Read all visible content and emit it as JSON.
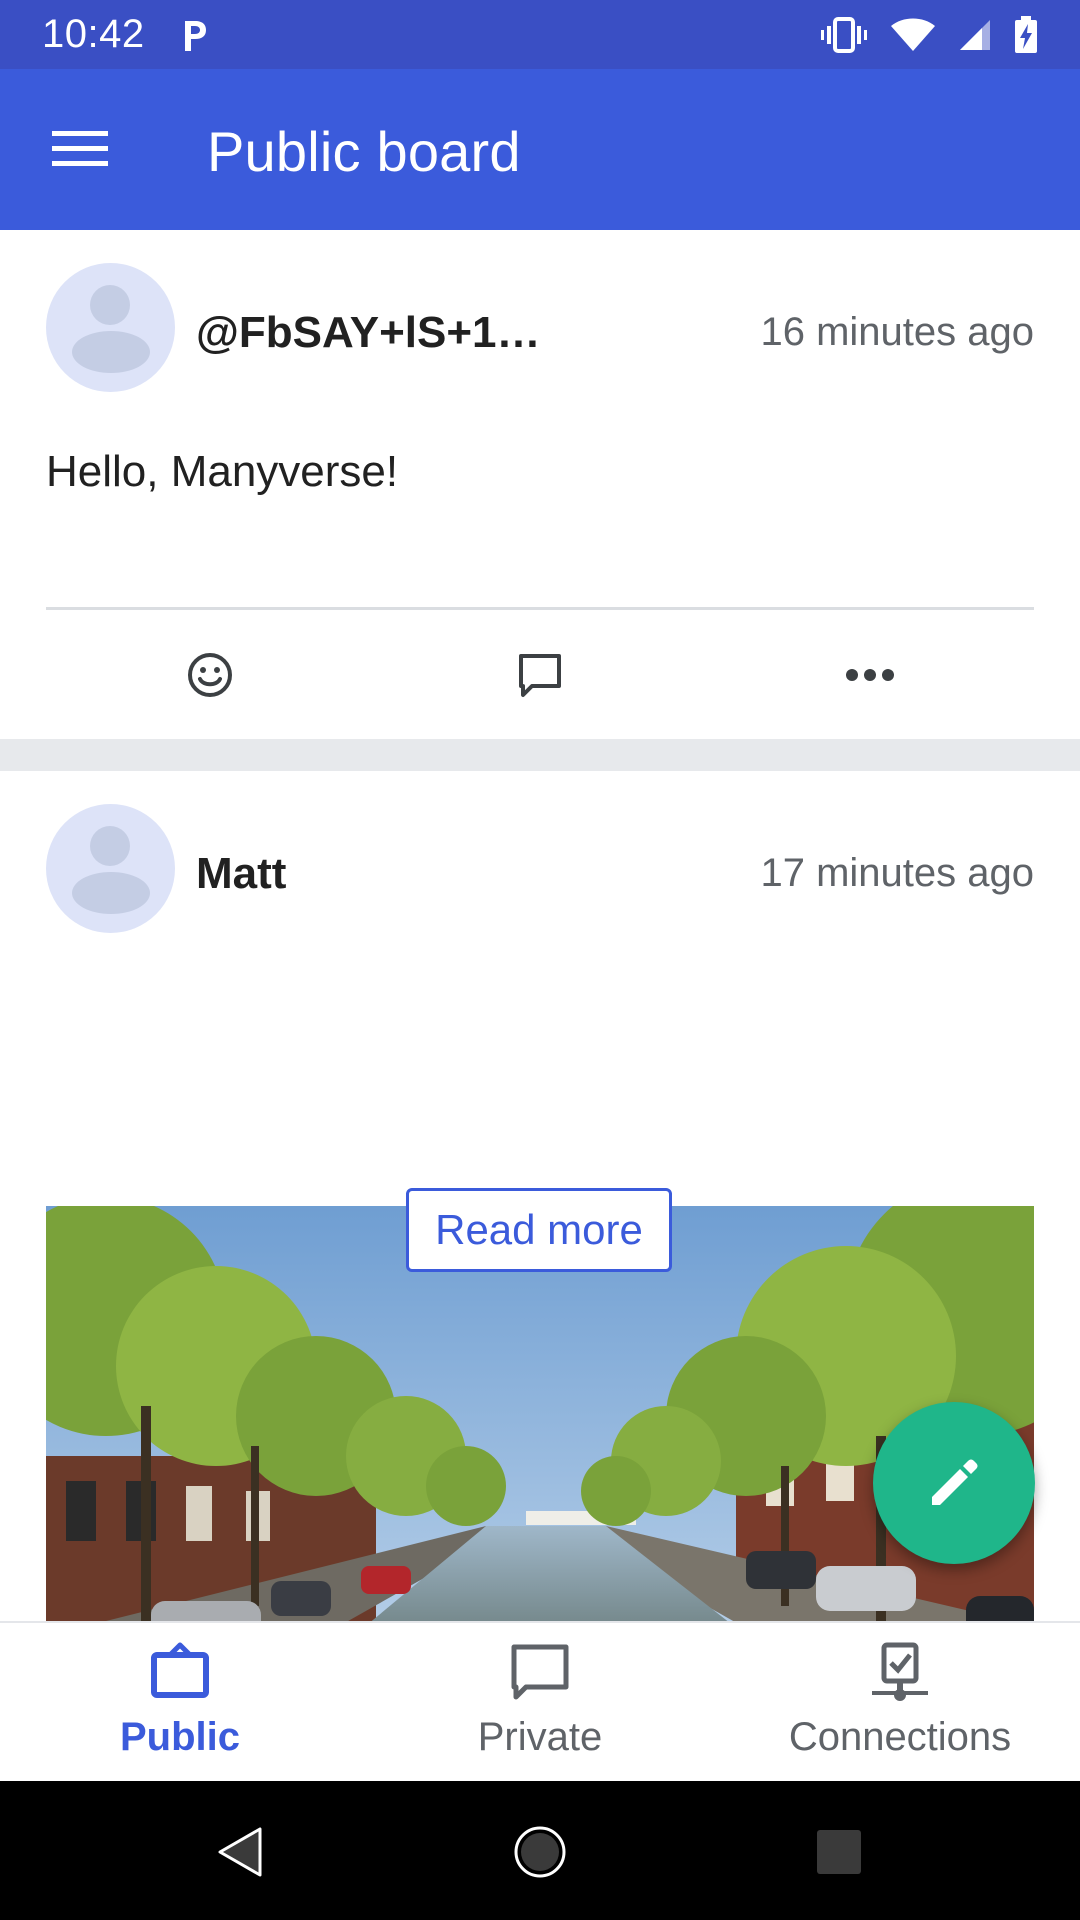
{
  "status_bar": {
    "time": "10:42",
    "icons": [
      "parking-notification-icon",
      "vibrate-icon",
      "wifi-icon",
      "cell-signal-icon",
      "battery-charging-icon"
    ]
  },
  "app_bar": {
    "title": "Public board",
    "menu_icon": "hamburger-menu-icon"
  },
  "feed": {
    "posts": [
      {
        "author": "@FbSAY+lS+1…",
        "timestamp": "16 minutes ago",
        "text": "Hello, Manyverse!",
        "actions": [
          "reaction-smiley-icon",
          "reply-comment-icon",
          "more-options-icon"
        ]
      },
      {
        "author": "Matt",
        "timestamp": "17 minutes ago",
        "image": "canal-street-photo",
        "read_more_label": "Read more"
      }
    ]
  },
  "fab": {
    "icon": "pencil-icon"
  },
  "bottom_nav": {
    "items": [
      {
        "label": "Public",
        "icon": "public-board-icon",
        "active": true
      },
      {
        "label": "Private",
        "icon": "private-chat-icon",
        "active": false
      },
      {
        "label": "Connections",
        "icon": "connections-icon",
        "active": false
      }
    ]
  },
  "system_nav": {
    "buttons": [
      "back-icon",
      "home-icon",
      "recents-icon"
    ]
  },
  "colors": {
    "status_bar": "#3a4fc4",
    "app_bar": "#3b5bdb",
    "accent": "#3b5bdb",
    "fab": "#1fb68a",
    "separator": "#e7e9ec"
  }
}
